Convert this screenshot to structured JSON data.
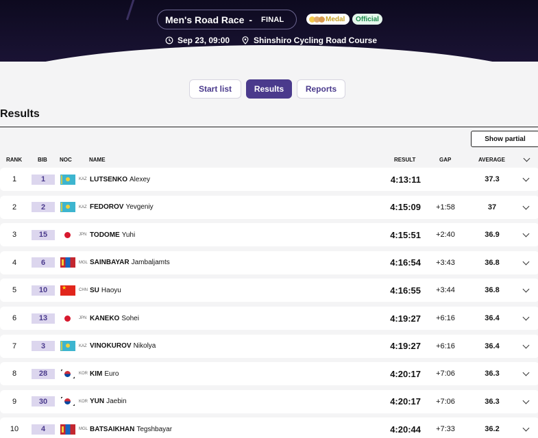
{
  "header": {
    "event": "Men's Road Race",
    "dash": "-",
    "phase": "FINAL",
    "medal_label": "Medal",
    "official_label": "Official",
    "datetime": "Sep 23, 09:00",
    "venue": "Shinshiro Cycling Road Course"
  },
  "tabs": [
    {
      "label": "Start list",
      "active": false
    },
    {
      "label": "Results",
      "active": true
    },
    {
      "label": "Reports",
      "active": false
    }
  ],
  "section_title": "Results",
  "show_partial_label": "Show partial",
  "columns": {
    "rank": "RANK",
    "bib": "BIB",
    "noc": "NOC",
    "name": "NAME",
    "result": "RESULT",
    "gap": "GAP",
    "average": "AVERAGE"
  },
  "rows": [
    {
      "rank": "1",
      "bib": "1",
      "noc": "KAZ",
      "surname": "LUTSENKO",
      "given": "Alexey",
      "result": "4:13:11",
      "gap": "",
      "average": "37.3"
    },
    {
      "rank": "2",
      "bib": "2",
      "noc": "KAZ",
      "surname": "FEDOROV",
      "given": "Yevgeniy",
      "result": "4:15:09",
      "gap": "+1:58",
      "average": "37"
    },
    {
      "rank": "3",
      "bib": "15",
      "noc": "JPN",
      "surname": "TODOME",
      "given": "Yuhi",
      "result": "4:15:51",
      "gap": "+2:40",
      "average": "36.9"
    },
    {
      "rank": "4",
      "bib": "6",
      "noc": "MGL",
      "surname": "SAINBAYAR",
      "given": "Jambaljamts",
      "result": "4:16:54",
      "gap": "+3:43",
      "average": "36.8"
    },
    {
      "rank": "5",
      "bib": "10",
      "noc": "CHN",
      "surname": "SU",
      "given": "Haoyu",
      "result": "4:16:55",
      "gap": "+3:44",
      "average": "36.8"
    },
    {
      "rank": "6",
      "bib": "13",
      "noc": "JPN",
      "surname": "KANEKO",
      "given": "Sohei",
      "result": "4:19:27",
      "gap": "+6:16",
      "average": "36.4"
    },
    {
      "rank": "7",
      "bib": "3",
      "noc": "KAZ",
      "surname": "VINOKUROV",
      "given": "Nikolya",
      "result": "4:19:27",
      "gap": "+6:16",
      "average": "36.4"
    },
    {
      "rank": "8",
      "bib": "28",
      "noc": "KOR",
      "surname": "KIM",
      "given": "Euro",
      "result": "4:20:17",
      "gap": "+7:06",
      "average": "36.3"
    },
    {
      "rank": "9",
      "bib": "30",
      "noc": "KOR",
      "surname": "YUN",
      "given": "Jaebin",
      "result": "4:20:17",
      "gap": "+7:06",
      "average": "36.3"
    },
    {
      "rank": "10",
      "bib": "4",
      "noc": "MGL",
      "surname": "BATSAIKHAN",
      "given": "Tegshbayar",
      "result": "4:20:44",
      "gap": "+7:33",
      "average": "36.2"
    }
  ],
  "colors": {
    "accent": "#4a3a8c",
    "header_bg": "#0d0a1f",
    "official": "#1c8a4c",
    "medal": "#c9a227"
  },
  "icons": {
    "datetime": "clock-icon",
    "venue": "location-pin-icon",
    "expand": "chevron-down-icon"
  }
}
